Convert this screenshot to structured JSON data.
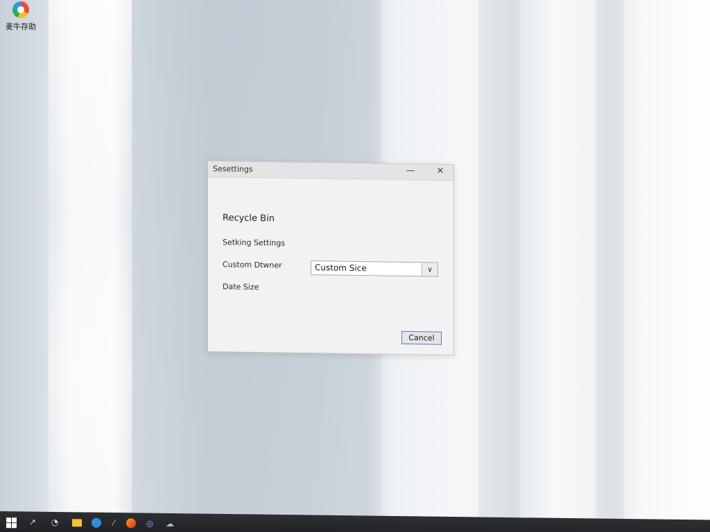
{
  "desktop": {
    "icon_label": "麦牛存助"
  },
  "dialog": {
    "title": "Sesettings",
    "minimize_glyph": "—",
    "close_glyph": "✕",
    "heading": "Recycle Bin",
    "setting_label": "Setking Settings",
    "custom_label": "Custom Dtwner",
    "size_label": "Date Size",
    "combo_value": "Custom Sice",
    "combo_arrow": "∨",
    "cancel_label": "Cancel"
  },
  "taskbar": {
    "items": [
      {
        "icon": "windows-icon"
      },
      {
        "icon": "chart-icon",
        "glyph": "↗"
      },
      {
        "icon": "clock-icon",
        "glyph": "◔"
      },
      {
        "icon": "folder-icon"
      },
      {
        "icon": "globe-icon"
      },
      {
        "icon": "pen-icon",
        "glyph": "⁄"
      },
      {
        "icon": "firefox-icon"
      },
      {
        "icon": "browser-icon",
        "glyph": "◎"
      },
      {
        "icon": "cloud-icon",
        "glyph": "☁"
      }
    ]
  }
}
